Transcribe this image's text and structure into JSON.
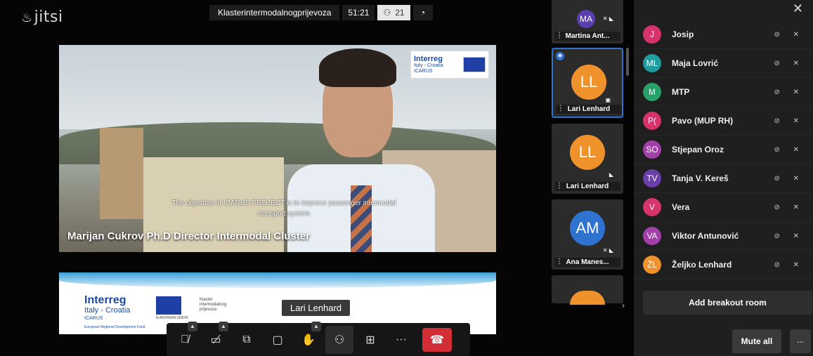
{
  "app": {
    "logo": "jitsi"
  },
  "topbar": {
    "meeting_title": "Klasterintermodalnogprijevoza",
    "timer": "51:21",
    "participant_count": "21"
  },
  "video": {
    "banner_brand": "Interreg",
    "banner_sub": "Italy - Croatia",
    "banner_project": "ICARUS",
    "caption": "The objective of ICARUS PROJECT is to improve passenger intermodal transport system",
    "lower_third": "Marijan Cukrov Ph.D Director Intermodal Cluster"
  },
  "slide": {
    "brand": "Interreg",
    "sub": "Italy - Croatia",
    "project": "ICARUS",
    "fund": "European Regional Development Fund",
    "eu_label": "EUROPEAN UNION",
    "klaster": [
      "Klaster",
      "intermodalnog",
      "prijevoza"
    ]
  },
  "dominant_speaker_label": "Lari Lenhard",
  "filmstrip": [
    {
      "initials": "MA",
      "name": "Martina Ant...",
      "color": "#5b3fb0"
    },
    {
      "initials": "LL",
      "name": "Lari Lenhard",
      "color": "#f0922b"
    },
    {
      "initials": "LL",
      "name": "Lari Lenhard",
      "color": "#f0922b"
    },
    {
      "initials": "AM",
      "name": "Ana Manes...",
      "color": "#2f73d1"
    }
  ],
  "participants": [
    {
      "initials": "J",
      "name": "Josip",
      "color": "#d6336c"
    },
    {
      "initials": "ML",
      "name": "Maja Lovrić",
      "color": "#1e9c9e"
    },
    {
      "initials": "M",
      "name": "MTP",
      "color": "#26a269"
    },
    {
      "initials": "P(",
      "name": "Pavo (MUP RH)",
      "color": "#d6336c"
    },
    {
      "initials": "SO",
      "name": "Stjepan Oroz",
      "color": "#a33fa8"
    },
    {
      "initials": "TV",
      "name": "Tanja V. Kereš",
      "color": "#6b3fa8"
    },
    {
      "initials": "V",
      "name": "Vera",
      "color": "#d6336c"
    },
    {
      "initials": "VA",
      "name": "Viktor Antunović",
      "color": "#a33fa8"
    },
    {
      "initials": "ŽL",
      "name": "Željko Lenhard",
      "color": "#f0922b"
    }
  ],
  "panel": {
    "breakout_label": "Add breakout room",
    "mute_all_label": "Mute all",
    "more_label": "..."
  }
}
